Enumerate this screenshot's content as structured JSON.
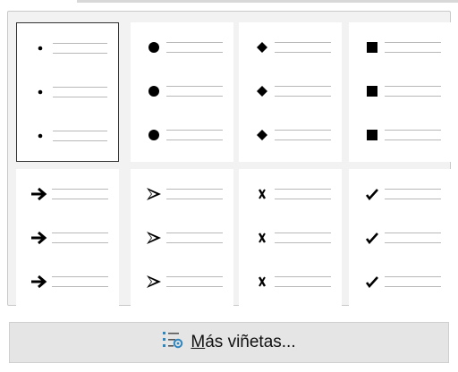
{
  "gallery": {
    "selected_index": 0,
    "styles": [
      {
        "name": "small-dot",
        "icon": "bullet-small-dot-icon"
      },
      {
        "name": "large-dot",
        "icon": "bullet-large-dot-icon"
      },
      {
        "name": "diamond",
        "icon": "bullet-diamond-icon"
      },
      {
        "name": "square",
        "icon": "bullet-square-icon"
      },
      {
        "name": "arrow",
        "icon": "bullet-arrow-icon"
      },
      {
        "name": "arrowhead",
        "icon": "bullet-arrowhead-icon"
      },
      {
        "name": "cross",
        "icon": "bullet-cross-icon"
      },
      {
        "name": "check",
        "icon": "bullet-check-icon"
      }
    ]
  },
  "more_button": {
    "label": "Más viñetas...",
    "icon": "bullet-settings-icon"
  },
  "colors": {
    "selected_border": "#333333",
    "gallery_background": "#f2f2f2",
    "button_background": "#e5e5e5",
    "settings_icon_accent": "#2e86c1"
  }
}
